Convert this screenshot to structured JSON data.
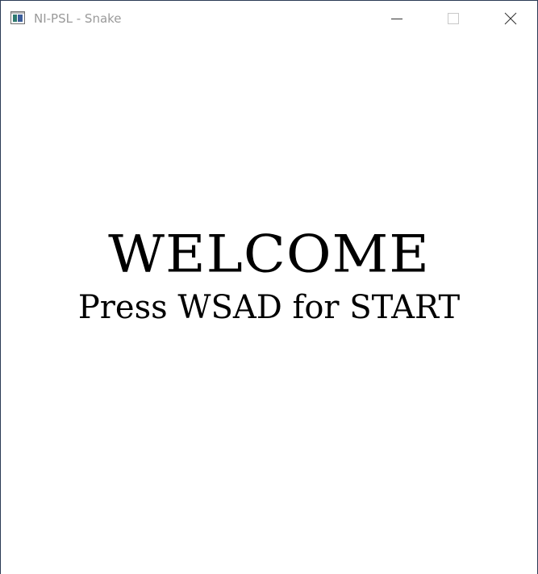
{
  "window": {
    "title": "NI-PSL - Snake",
    "controls": {
      "minimize_icon": "minimize-icon",
      "maximize_icon": "maximize-icon",
      "close_icon": "close-icon"
    },
    "border_color": "#2b3a55"
  },
  "game": {
    "welcome_text": "WELCOME",
    "prompt_text": "Press WSAD for START",
    "background_color": "#ffffff",
    "text_color": "#000000"
  }
}
